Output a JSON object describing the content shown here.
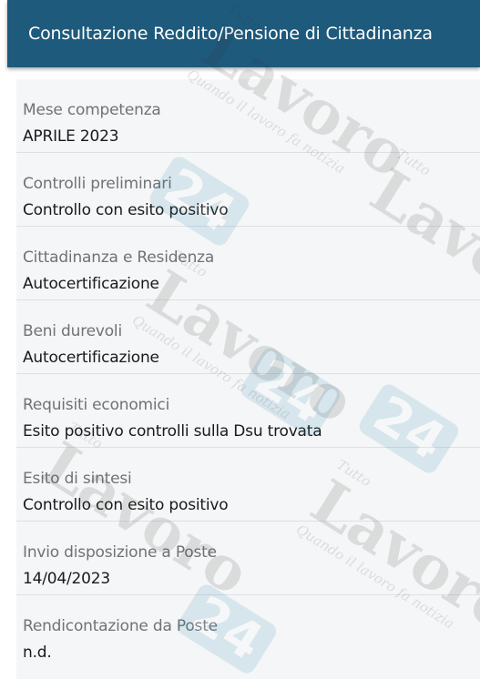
{
  "header": {
    "title": "Consultazione Reddito/Pensione di Cittadinanza"
  },
  "details": [
    {
      "label": "Mese competenza",
      "value": "APRILE 2023"
    },
    {
      "label": "Controlli preliminari",
      "value": "Controllo con esito positivo"
    },
    {
      "label": "Cittadinanza e Residenza",
      "value": "Autocertificazione"
    },
    {
      "label": "Beni durevoli",
      "value": "Autocertificazione"
    },
    {
      "label": "Requisiti economici",
      "value": "Esito positivo controlli sulla Dsu trovata"
    },
    {
      "label": "Esito di sintesi",
      "value": "Controllo con esito positivo"
    },
    {
      "label": "Invio disposizione a Poste",
      "value": "14/04/2023"
    },
    {
      "label": "Rendicontazione da Poste",
      "value": "n.d."
    }
  ],
  "watermark": {
    "brand_top": "Tutto",
    "brand_main": "Lavoro",
    "brand_number": "24",
    "tagline": "Quando il lavoro fa notizia"
  },
  "colors": {
    "header_bg": "#1e5a7c",
    "content_bg": "#f4f6f7",
    "label_text": "#6f7377",
    "value_text": "#1a1a1a",
    "watermark_badge": "#1e7fa8"
  }
}
